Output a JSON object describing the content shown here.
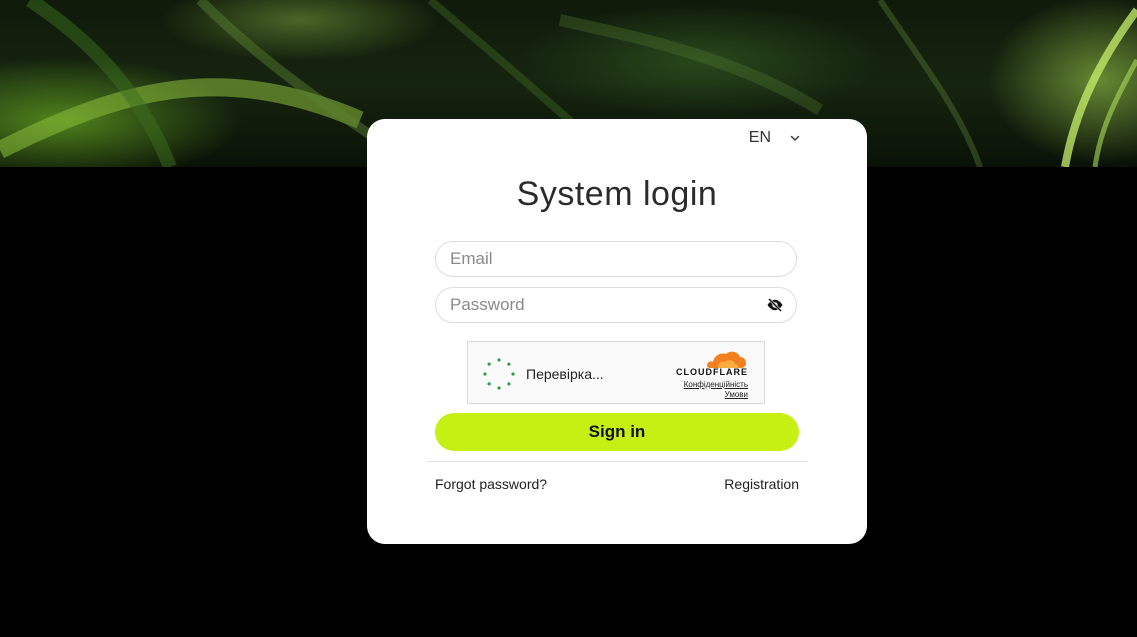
{
  "language": {
    "selected": "EN"
  },
  "login": {
    "title": "System login",
    "email_placeholder": "Email",
    "password_placeholder": "Password",
    "sign_in_label": "Sign in",
    "forgot_password_label": "Forgot password?",
    "registration_label": "Registration"
  },
  "captcha": {
    "status_text": "Перевірка...",
    "brand": "CLOUDFLARE",
    "privacy_link": "Конфіденційність",
    "terms_link": "Умови"
  },
  "colors": {
    "accent": "#c6ef13",
    "cloudflare_orange": "#f38020",
    "spinner_green": "#2e9e4b"
  },
  "icons": {
    "language_dropdown": "chevron-down-icon",
    "password_toggle": "eye-slash-icon",
    "captcha_spinner": "spinner-icon",
    "captcha_brand": "cloudflare-logo-icon"
  }
}
